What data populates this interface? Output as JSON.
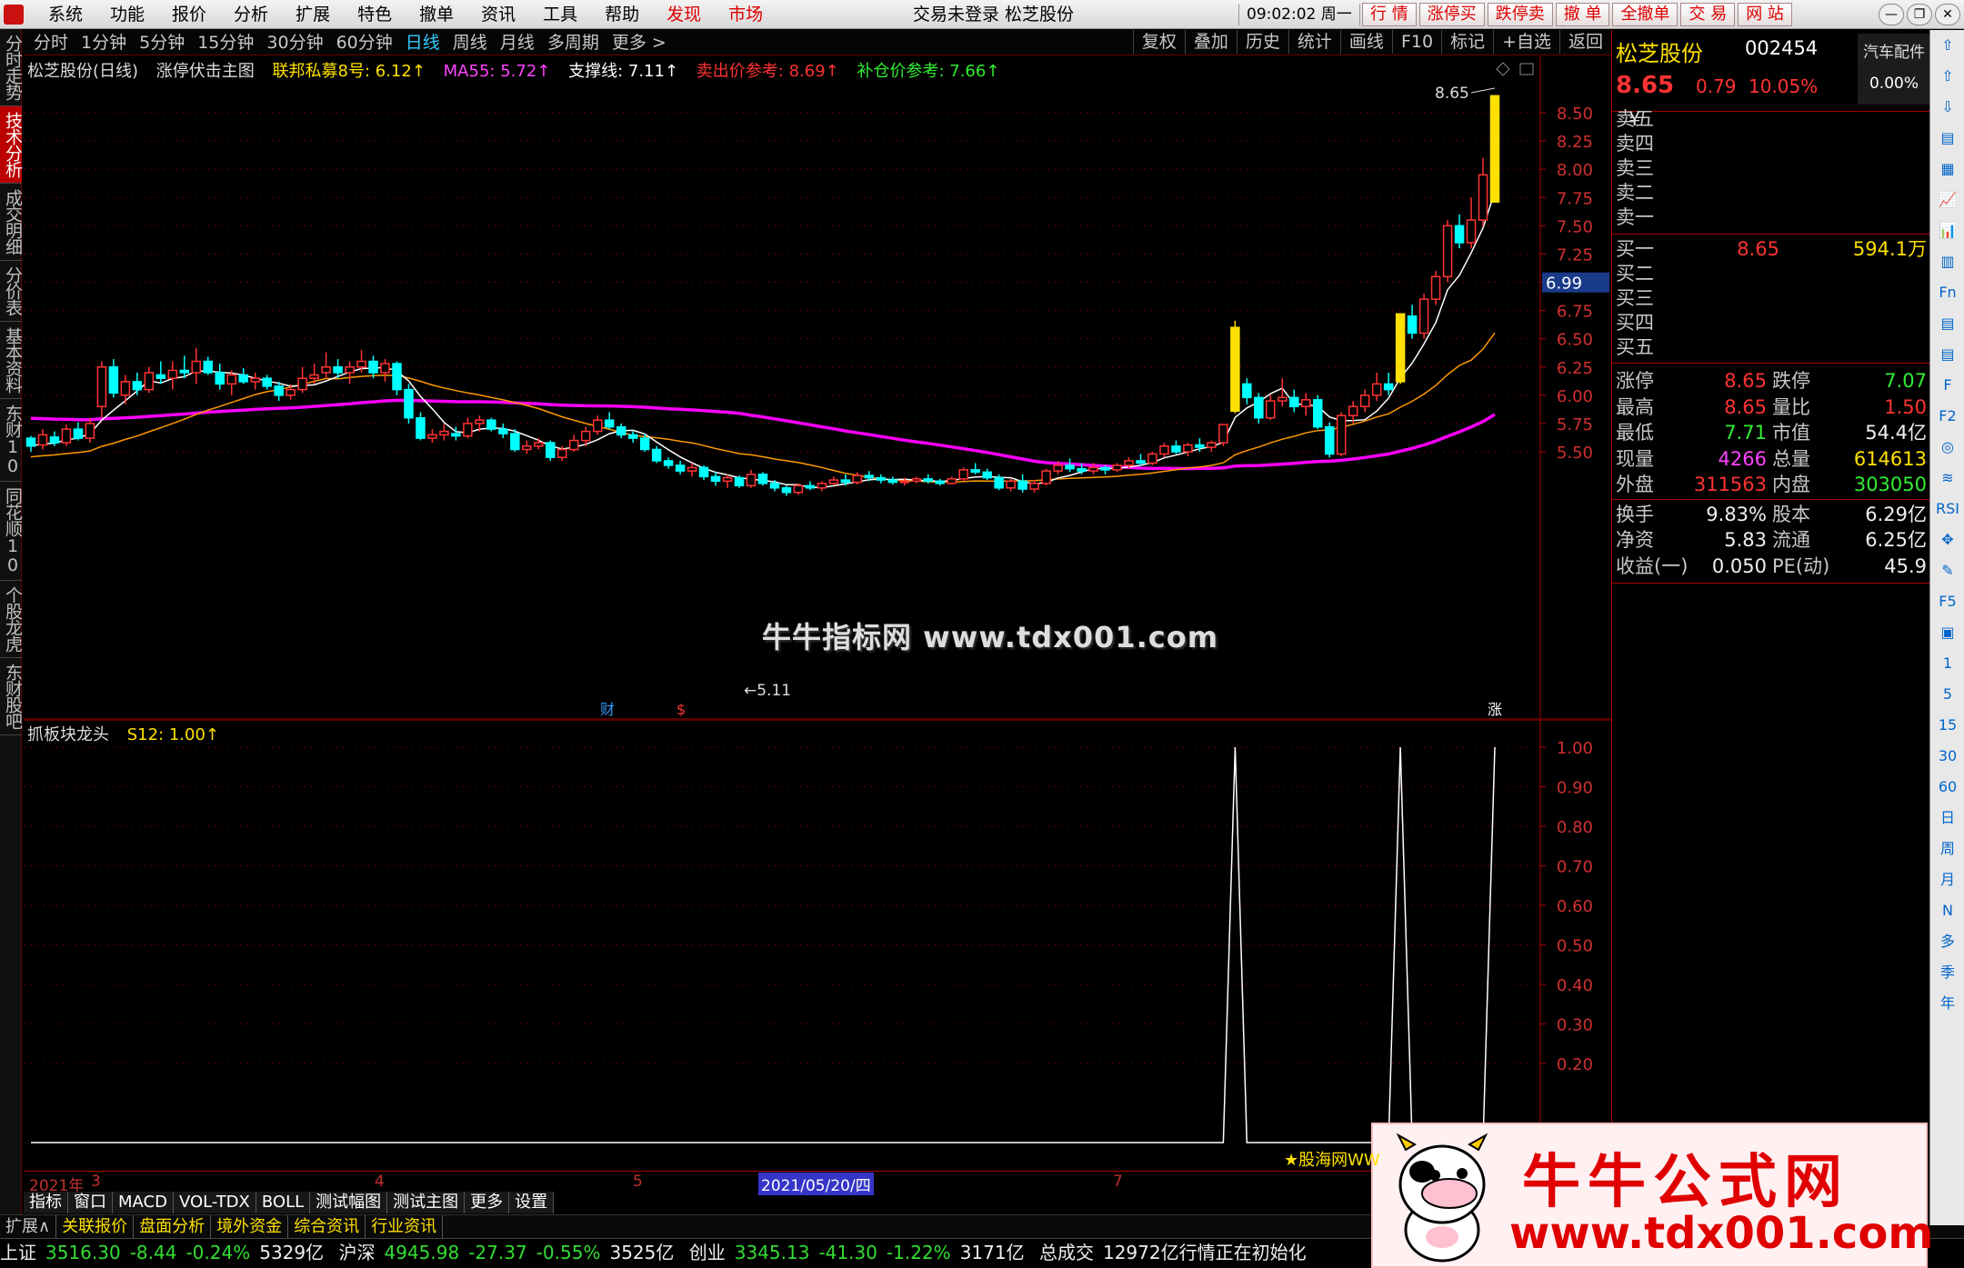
{
  "menu": {
    "items": [
      "系统",
      "功能",
      "报价",
      "分析",
      "扩展",
      "特色",
      "撤单",
      "资讯",
      "工具",
      "帮助"
    ],
    "red_items": [
      "发现",
      "市场"
    ],
    "title": "交易未登录  松芝股份",
    "clock": "09:02:02 周一",
    "quick": [
      "行 情",
      "涨停买",
      "跌停卖",
      "撤 单",
      "全撤单",
      "交 易",
      "网 站"
    ]
  },
  "left_tabs": [
    {
      "label": "分时走势",
      "active": false
    },
    {
      "label": "技术分析",
      "active": true
    },
    {
      "label": "成交明细",
      "active": false
    },
    {
      "label": "分价表",
      "active": false
    },
    {
      "label": "基本资料",
      "active": false
    },
    {
      "label": "东财10",
      "active": false
    },
    {
      "label": "同花顺10",
      "active": false
    },
    {
      "label": "个股龙虎",
      "active": false
    },
    {
      "label": "东财股吧",
      "active": false
    }
  ],
  "chart_toolbar": {
    "periods": [
      "分时",
      "1分钟",
      "5分钟",
      "15分钟",
      "30分钟",
      "60分钟",
      "日线",
      "周线",
      "月线",
      "多周期",
      "更多 >"
    ],
    "selected": "日线",
    "tools": [
      "复权",
      "叠加",
      "历史",
      "统计",
      "画线",
      "F10",
      "标记",
      "+自选",
      "返回"
    ]
  },
  "main_legend": {
    "stock": "松芝股份(日线)",
    "indicator": "涨停伏击主图",
    "l1": "联邦私募8号: 6.12↑",
    "l2": "MA55: 5.72↑",
    "l3": "支撑线: 7.11↑",
    "l4": "卖出价参考: 8.69↑",
    "l5": "补仓价参考: 7.66↑"
  },
  "main_axis": {
    "ticks": [
      "8.50",
      "8.25",
      "8.00",
      "7.75",
      "7.50",
      "7.25",
      "7.00",
      "6.75",
      "6.50",
      "6.25",
      "6.00",
      "5.75",
      "5.50"
    ],
    "price_tag": "6.99",
    "high_label": "8.65",
    "low_label": "←5.11",
    "markers": [
      "财",
      "$",
      "涨"
    ]
  },
  "sub_legend": {
    "name": "抓板块龙头",
    "value": "S12: 1.00↑"
  },
  "sub_axis": {
    "ticks": [
      "1.00",
      "0.90",
      "0.80",
      "0.70",
      "0.60",
      "0.50",
      "0.40",
      "0.30",
      "0.20"
    ]
  },
  "date_axis": {
    "labels": [
      "2021年",
      "3",
      "4",
      "5",
      "7"
    ],
    "cursor": "2021/05/20/四"
  },
  "bottom_tabs": [
    "指标",
    "窗口",
    "MACD",
    "VOL-TDX",
    "BOLL",
    "测试幅图",
    "测试主图",
    "更多",
    "设置"
  ],
  "bottom_tabs2": [
    "扩展∧",
    "关联报价",
    "盘面分析",
    "境外资金",
    "综合资讯",
    "行业资讯"
  ],
  "status": {
    "sh_name": "上证",
    "sh_val": "3516.30",
    "sh_chg": "-8.44",
    "sh_pct": "-0.24%",
    "sh_amt": "5329亿",
    "hs_name": "沪深",
    "hs_val": "4945.98",
    "hs_chg": "-27.37",
    "hs_pct": "-0.55%",
    "hs_amt": "3525亿",
    "cy_name": "创业",
    "cy_val": "3345.13",
    "cy_chg": "-41.30",
    "cy_pct": "-1.22%",
    "cy_amt": "3171亿",
    "total_label": "总成交",
    "total_val": "12972亿",
    "note": "行情正在初始化"
  },
  "quote": {
    "name": "松芝股份",
    "code": "002454",
    "sector": "汽车配件",
    "sector_pct": "0.00%",
    "price": "8.65",
    "chg": "0.79",
    "pct": "10.05%",
    "asks": [
      {
        "label": "卖五",
        "price": "¥",
        "vol": ""
      },
      {
        "label": "卖四",
        "price": "",
        "vol": ""
      },
      {
        "label": "卖三",
        "price": "",
        "vol": ""
      },
      {
        "label": "卖二",
        "price": "",
        "vol": ""
      },
      {
        "label": "卖一",
        "price": "",
        "vol": ""
      }
    ],
    "bids": [
      {
        "label": "买一",
        "price": "8.65",
        "vol": "594.1万"
      },
      {
        "label": "买二",
        "price": "",
        "vol": ""
      },
      {
        "label": "买三",
        "price": "",
        "vol": ""
      },
      {
        "label": "买四",
        "price": "",
        "vol": ""
      },
      {
        "label": "买五",
        "price": "",
        "vol": ""
      }
    ],
    "stats": [
      {
        "l": "涨停",
        "v": "8.65",
        "vc": "up",
        "l2": "跌停",
        "v2": "7.07",
        "v2c": "dn"
      },
      {
        "l": "最高",
        "v": "8.65",
        "vc": "up",
        "l2": "量比",
        "v2": "1.50",
        "v2c": "up"
      },
      {
        "l": "最低",
        "v": "7.71",
        "vc": "dn",
        "l2": "市值",
        "v2": "54.4亿",
        "v2c": "wh"
      },
      {
        "l": "现量",
        "v": "4266",
        "vc": "mg",
        "l2": "总量",
        "v2": "614613",
        "v2c": "ye"
      },
      {
        "l": "外盘",
        "v": "311563",
        "vc": "up",
        "l2": "内盘",
        "v2": "303050",
        "v2c": "dn"
      },
      {
        "l": "换手",
        "v": "9.83%",
        "vc": "wh",
        "l2": "股本",
        "v2": "6.29亿",
        "v2c": "wh"
      },
      {
        "l": "净资",
        "v": "5.83",
        "vc": "wh",
        "l2": "流通",
        "v2": "6.25亿",
        "v2c": "wh"
      },
      {
        "l": "收益(一)",
        "v": "0.050",
        "vc": "wh",
        "l2": "PE(动)",
        "v2": "45.9",
        "v2c": "wh"
      }
    ]
  },
  "right_tools": [
    "⇧",
    "⇧",
    "⇩",
    "▤",
    "▦",
    "📈",
    "📊",
    "▥",
    "Fn",
    "▤",
    "▤",
    "F",
    "F2",
    "◎",
    "≋",
    "RSI",
    "✥",
    "✎",
    "F5",
    "▣",
    "1",
    "5",
    "15",
    "30",
    "60",
    "日",
    "周",
    "月",
    "N",
    "多",
    "季",
    "年"
  ],
  "watermark": "牛牛指标网 www.tdx001.com",
  "ad": {
    "title": "牛牛公式网",
    "url": "www.tdx001.com",
    "sub": "★股海网WW"
  },
  "colors": {
    "up": "#ff3333",
    "down": "#00ffff",
    "ma_white": "#ffffff",
    "ma_orange": "#ff9900",
    "ma_magenta": "#ff00ff",
    "zt_yellow": "#ffe000"
  },
  "chart_data": {
    "type": "candlestick",
    "ohlc": [
      [
        5.62,
        5.64,
        5.5,
        5.55
      ],
      [
        5.56,
        5.7,
        5.52,
        5.65
      ],
      [
        5.63,
        5.68,
        5.55,
        5.58
      ],
      [
        5.58,
        5.74,
        5.55,
        5.7
      ],
      [
        5.7,
        5.76,
        5.6,
        5.62
      ],
      [
        5.62,
        5.8,
        5.58,
        5.75
      ],
      [
        5.9,
        6.3,
        5.8,
        6.25
      ],
      [
        6.25,
        6.32,
        5.98,
        6.02
      ],
      [
        6.0,
        6.18,
        5.92,
        6.12
      ],
      [
        6.12,
        6.2,
        6.0,
        6.05
      ],
      [
        6.05,
        6.25,
        6.02,
        6.2
      ],
      [
        6.18,
        6.3,
        6.1,
        6.15
      ],
      [
        6.15,
        6.3,
        6.05,
        6.22
      ],
      [
        6.22,
        6.35,
        6.15,
        6.2
      ],
      [
        6.2,
        6.42,
        6.1,
        6.3
      ],
      [
        6.3,
        6.34,
        6.18,
        6.2
      ],
      [
        6.2,
        6.28,
        6.05,
        6.1
      ],
      [
        6.1,
        6.22,
        6.0,
        6.18
      ],
      [
        6.18,
        6.24,
        6.1,
        6.12
      ],
      [
        6.12,
        6.2,
        6.05,
        6.15
      ],
      [
        6.15,
        6.18,
        6.05,
        6.08
      ],
      [
        6.08,
        6.12,
        5.95,
        6.0
      ],
      [
        6.0,
        6.1,
        5.96,
        6.05
      ],
      [
        6.05,
        6.25,
        6.02,
        6.15
      ],
      [
        6.15,
        6.28,
        6.1,
        6.18
      ],
      [
        6.2,
        6.38,
        6.15,
        6.25
      ],
      [
        6.25,
        6.32,
        6.15,
        6.2
      ],
      [
        6.2,
        6.3,
        6.1,
        6.25
      ],
      [
        6.25,
        6.4,
        6.2,
        6.3
      ],
      [
        6.3,
        6.35,
        6.15,
        6.2
      ],
      [
        6.2,
        6.32,
        6.12,
        6.28
      ],
      [
        6.28,
        6.3,
        6.0,
        6.05
      ],
      [
        6.05,
        6.1,
        5.75,
        5.8
      ],
      [
        5.8,
        5.85,
        5.6,
        5.62
      ],
      [
        5.62,
        5.7,
        5.58,
        5.65
      ],
      [
        5.65,
        5.75,
        5.6,
        5.68
      ],
      [
        5.66,
        5.72,
        5.6,
        5.64
      ],
      [
        5.64,
        5.8,
        5.62,
        5.75
      ],
      [
        5.75,
        5.82,
        5.68,
        5.78
      ],
      [
        5.78,
        5.8,
        5.68,
        5.7
      ],
      [
        5.7,
        5.75,
        5.62,
        5.66
      ],
      [
        5.66,
        5.7,
        5.5,
        5.52
      ],
      [
        5.52,
        5.6,
        5.48,
        5.55
      ],
      [
        5.55,
        5.62,
        5.52,
        5.58
      ],
      [
        5.58,
        5.6,
        5.42,
        5.45
      ],
      [
        5.45,
        5.55,
        5.42,
        5.52
      ],
      [
        5.52,
        5.65,
        5.5,
        5.6
      ],
      [
        5.6,
        5.72,
        5.55,
        5.68
      ],
      [
        5.68,
        5.82,
        5.65,
        5.78
      ],
      [
        5.78,
        5.85,
        5.7,
        5.72
      ],
      [
        5.72,
        5.75,
        5.62,
        5.65
      ],
      [
        5.65,
        5.68,
        5.58,
        5.62
      ],
      [
        5.62,
        5.66,
        5.5,
        5.52
      ],
      [
        5.52,
        5.55,
        5.4,
        5.42
      ],
      [
        5.42,
        5.45,
        5.35,
        5.38
      ],
      [
        5.38,
        5.42,
        5.3,
        5.33
      ],
      [
        5.33,
        5.4,
        5.28,
        5.36
      ],
      [
        5.36,
        5.38,
        5.25,
        5.28
      ],
      [
        5.28,
        5.32,
        5.2,
        5.24
      ],
      [
        5.24,
        5.3,
        5.18,
        5.27
      ],
      [
        5.27,
        5.29,
        5.18,
        5.2
      ],
      [
        5.2,
        5.34,
        5.18,
        5.3
      ],
      [
        5.3,
        5.32,
        5.2,
        5.22
      ],
      [
        5.22,
        5.25,
        5.15,
        5.18
      ],
      [
        5.18,
        5.2,
        5.11,
        5.14
      ],
      [
        5.14,
        5.22,
        5.12,
        5.2
      ],
      [
        5.2,
        5.24,
        5.16,
        5.18
      ],
      [
        5.18,
        5.24,
        5.15,
        5.22
      ],
      [
        5.22,
        5.28,
        5.2,
        5.25
      ],
      [
        5.25,
        5.3,
        5.2,
        5.23
      ],
      [
        5.23,
        5.32,
        5.21,
        5.29
      ],
      [
        5.29,
        5.33,
        5.24,
        5.27
      ],
      [
        5.27,
        5.3,
        5.22,
        5.25
      ],
      [
        5.25,
        5.28,
        5.21,
        5.23
      ],
      [
        5.23,
        5.27,
        5.2,
        5.24
      ],
      [
        5.24,
        5.28,
        5.22,
        5.26
      ],
      [
        5.26,
        5.3,
        5.22,
        5.24
      ],
      [
        5.24,
        5.26,
        5.2,
        5.22
      ],
      [
        5.22,
        5.28,
        5.21,
        5.26
      ],
      [
        5.26,
        5.36,
        5.24,
        5.34
      ],
      [
        5.34,
        5.4,
        5.3,
        5.32
      ],
      [
        5.32,
        5.35,
        5.25,
        5.27
      ],
      [
        5.27,
        5.3,
        5.16,
        5.18
      ],
      [
        5.18,
        5.26,
        5.15,
        5.24
      ],
      [
        5.24,
        5.3,
        5.14,
        5.17
      ],
      [
        5.17,
        5.25,
        5.14,
        5.22
      ],
      [
        5.22,
        5.35,
        5.2,
        5.33
      ],
      [
        5.33,
        5.42,
        5.3,
        5.38
      ],
      [
        5.38,
        5.44,
        5.32,
        5.35
      ],
      [
        5.35,
        5.4,
        5.3,
        5.33
      ],
      [
        5.33,
        5.4,
        5.3,
        5.36
      ],
      [
        5.36,
        5.38,
        5.3,
        5.34
      ],
      [
        5.34,
        5.4,
        5.32,
        5.38
      ],
      [
        5.38,
        5.45,
        5.35,
        5.42
      ],
      [
        5.42,
        5.48,
        5.38,
        5.4
      ],
      [
        5.4,
        5.5,
        5.38,
        5.48
      ],
      [
        5.48,
        5.58,
        5.45,
        5.55
      ],
      [
        5.55,
        5.6,
        5.48,
        5.5
      ],
      [
        5.5,
        5.58,
        5.46,
        5.56
      ],
      [
        5.56,
        5.62,
        5.5,
        5.54
      ],
      [
        5.54,
        5.6,
        5.5,
        5.58
      ],
      [
        5.58,
        5.74,
        5.55,
        5.74
      ],
      [
        5.86,
        6.66,
        5.84,
        6.6
      ],
      [
        6.1,
        6.15,
        5.92,
        5.98
      ],
      [
        5.98,
        6.02,
        5.75,
        5.8
      ],
      [
        5.8,
        6.0,
        5.78,
        5.95
      ],
      [
        5.95,
        6.15,
        5.9,
        5.98
      ],
      [
        5.98,
        6.05,
        5.85,
        5.9
      ],
      [
        5.9,
        6.02,
        5.82,
        5.96
      ],
      [
        5.96,
        6.0,
        5.7,
        5.72
      ],
      [
        5.72,
        5.76,
        5.45,
        5.48
      ],
      [
        5.48,
        5.85,
        5.46,
        5.82
      ],
      [
        5.82,
        5.95,
        5.75,
        5.9
      ],
      [
        5.9,
        6.05,
        5.85,
        6.0
      ],
      [
        6.0,
        6.2,
        5.95,
        6.1
      ],
      [
        6.1,
        6.2,
        6.0,
        6.05
      ],
      [
        6.12,
        6.72,
        6.1,
        6.72
      ],
      [
        6.7,
        6.8,
        6.5,
        6.55
      ],
      [
        6.55,
        6.9,
        6.5,
        6.85
      ],
      [
        6.85,
        7.1,
        6.8,
        7.05
      ],
      [
        7.05,
        7.55,
        7.0,
        7.5
      ],
      [
        7.5,
        7.6,
        7.3,
        7.35
      ],
      [
        7.35,
        7.75,
        7.3,
        7.55
      ],
      [
        7.55,
        8.1,
        7.5,
        7.95
      ],
      [
        7.71,
        8.65,
        7.71,
        8.65
      ]
    ],
    "ylim": [
      5.0,
      8.75
    ]
  }
}
